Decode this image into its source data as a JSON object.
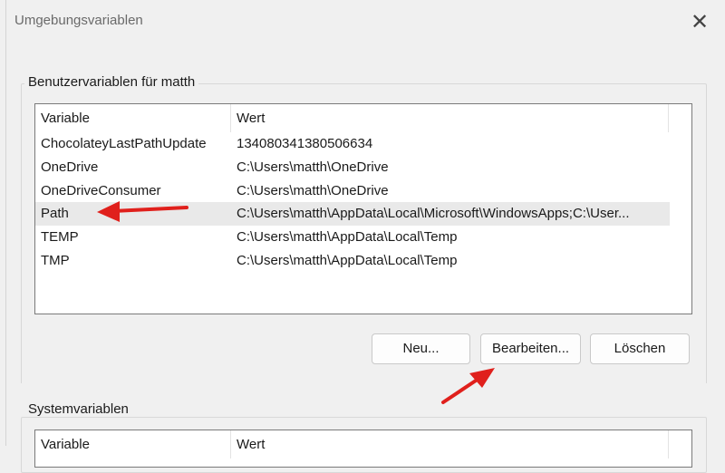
{
  "window": {
    "title": "Umgebungsvariablen",
    "close_symbol": "✕"
  },
  "user_vars": {
    "group_label": "Benutzervariablen für matth",
    "columns": [
      "Variable",
      "Wert"
    ],
    "rows": [
      {
        "name": "ChocolateyLastPathUpdate",
        "value": "134080341380506634"
      },
      {
        "name": "OneDrive",
        "value": "C:\\Users\\matth\\OneDrive"
      },
      {
        "name": "OneDriveConsumer",
        "value": "C:\\Users\\matth\\OneDrive"
      },
      {
        "name": "Path",
        "value": "C:\\Users\\matth\\AppData\\Local\\Microsoft\\WindowsApps;C:\\User..."
      },
      {
        "name": "TEMP",
        "value": "C:\\Users\\matth\\AppData\\Local\\Temp"
      },
      {
        "name": "TMP",
        "value": "C:\\Users\\matth\\AppData\\Local\\Temp"
      }
    ],
    "selected_row": 3,
    "buttons": {
      "new": "Neu...",
      "edit": "Bearbeiten...",
      "delete": "Löschen"
    }
  },
  "system_vars": {
    "group_label": "Systemvariablen",
    "columns": [
      "Variable",
      "Wert"
    ]
  },
  "annotations": {
    "arrow_color": "#e0201c"
  }
}
